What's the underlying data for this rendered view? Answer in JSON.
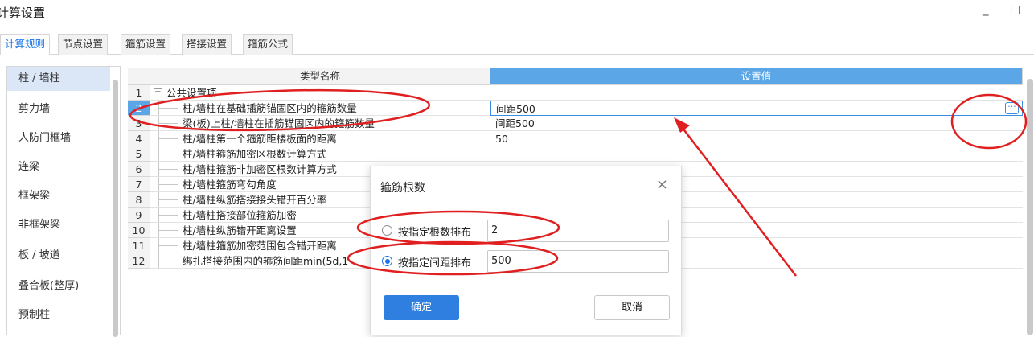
{
  "window": {
    "title": "计算设置",
    "minimize": "_",
    "maximize": "□"
  },
  "tabs": [
    {
      "label": "计算规则"
    },
    {
      "label": "节点设置"
    },
    {
      "label": "箍筋设置"
    },
    {
      "label": "搭接设置"
    },
    {
      "label": "箍筋公式"
    }
  ],
  "sidebar": {
    "items": [
      {
        "label": "柱 / 墙柱"
      },
      {
        "label": "剪力墙"
      },
      {
        "label": "人防门框墙"
      },
      {
        "label": "连梁"
      },
      {
        "label": "框架梁"
      },
      {
        "label": "非框架梁"
      },
      {
        "label": "板 / 坡道"
      },
      {
        "label": "叠合板(整厚)"
      },
      {
        "label": "预制柱"
      }
    ]
  },
  "grid": {
    "headers": {
      "name": "类型名称",
      "value": "设置值"
    },
    "rows": [
      {
        "num": "1",
        "name": "公共设置项",
        "value": ""
      },
      {
        "num": "2",
        "name": "柱/墙柱在基础插筋锚固区内的箍筋数量",
        "value": "间距500"
      },
      {
        "num": "3",
        "name": "梁(板)上柱/墙柱在插筋锚固区内的箍筋数量",
        "value": "间距500"
      },
      {
        "num": "4",
        "name": "柱/墙柱第一个箍筋距楼板面的距离",
        "value": "50"
      },
      {
        "num": "5",
        "name": "柱/墙柱箍筋加密区根数计算方式",
        "value": ""
      },
      {
        "num": "6",
        "name": "柱/墙柱箍筋非加密区根数计算方式",
        "value": ""
      },
      {
        "num": "7",
        "name": "柱/墙柱箍筋弯勾角度",
        "value": ""
      },
      {
        "num": "8",
        "name": "柱/墙柱纵筋搭接接头错开百分率",
        "value": ""
      },
      {
        "num": "9",
        "name": "柱/墙柱搭接部位箍筋加密",
        "value": ""
      },
      {
        "num": "10",
        "name": "柱/墙柱纵筋错开距离设置",
        "value": ""
      },
      {
        "num": "11",
        "name": "柱/墙柱箍筋加密范围包含错开距离",
        "value": ""
      },
      {
        "num": "12",
        "name": "绑扎搭接范围内的箍筋间距min(5d,1",
        "value": ""
      }
    ],
    "selected_row": 2,
    "expander_symbol": "−",
    "ellipsis_symbol": "···"
  },
  "dialog": {
    "title": "箍筋根数",
    "close": "×",
    "options": [
      {
        "label": "按指定根数排布",
        "value": "2",
        "checked": false
      },
      {
        "label": "按指定间距排布",
        "value": "500",
        "checked": true
      }
    ],
    "ok": "确定",
    "cancel": "取消"
  },
  "colors": {
    "accent": "#1a73e8",
    "header_selected": "#5aa6e6",
    "sidebar_active": "#dbe7f7",
    "annotation": "#e02020"
  }
}
